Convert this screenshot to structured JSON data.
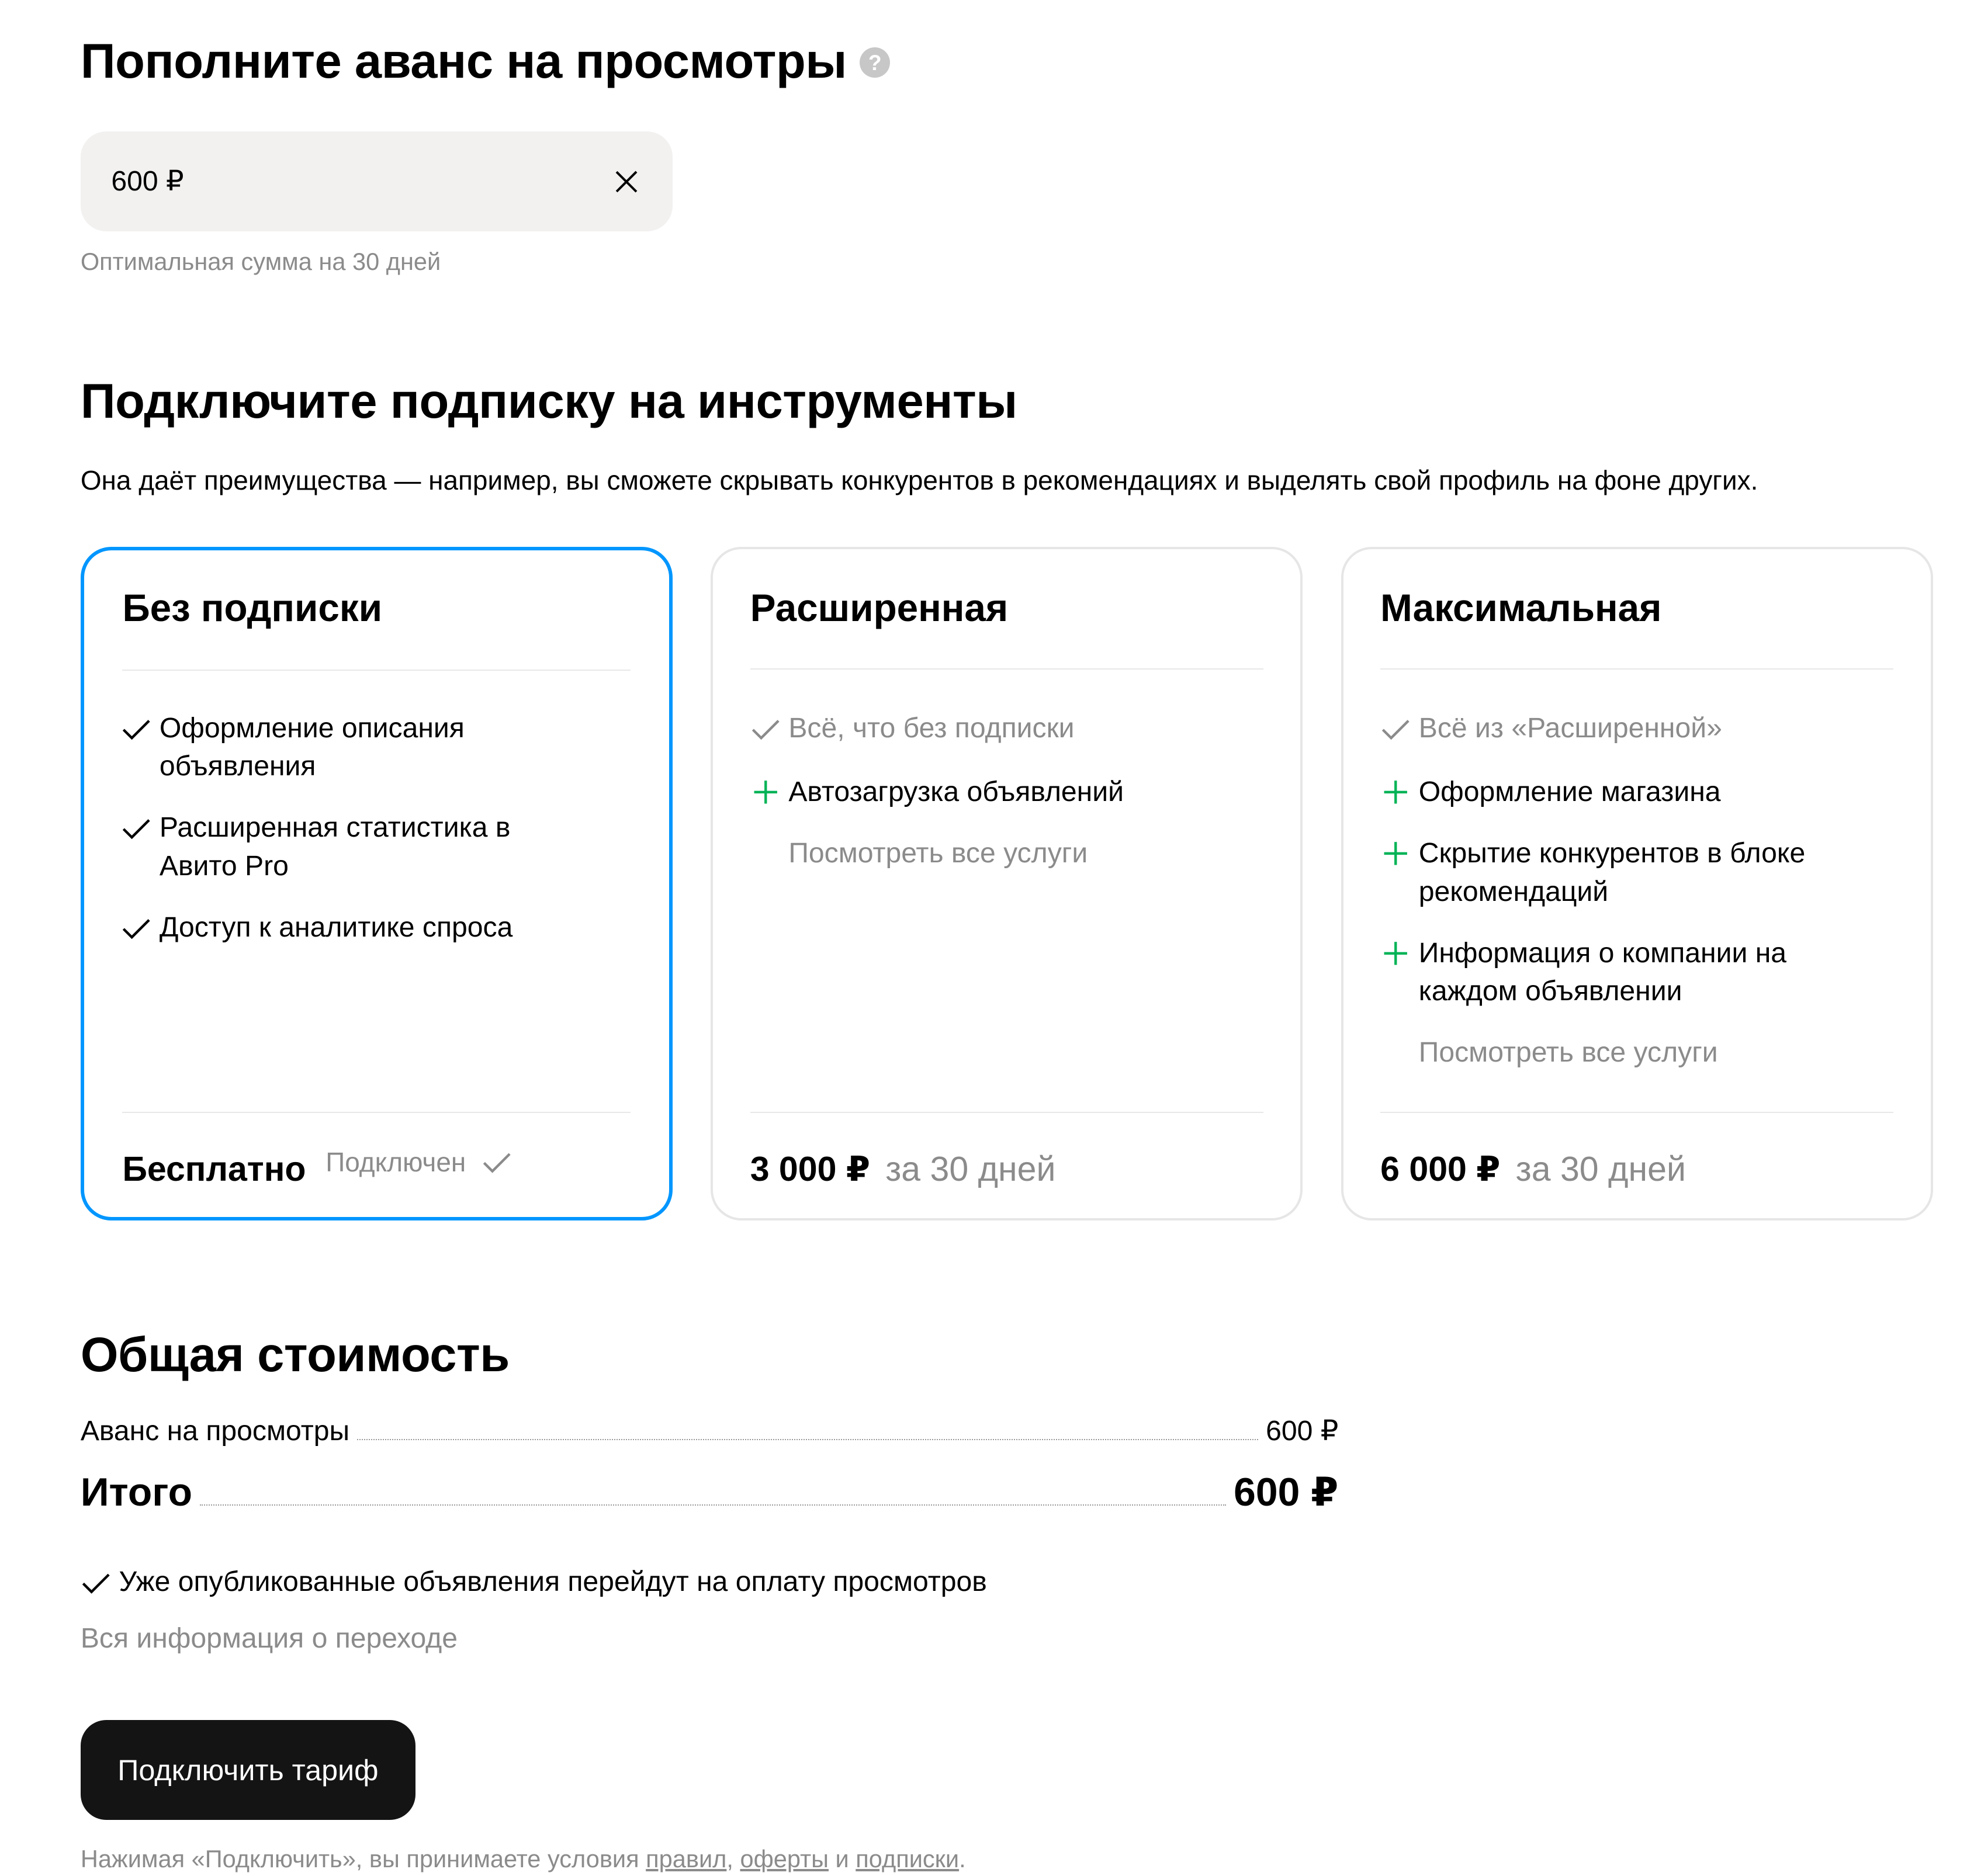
{
  "advance": {
    "title": "Пополните аванс на просмотры",
    "help_icon": "?",
    "amount_value": "600 ₽",
    "hint": "Оптимальная сумма на 30 дней"
  },
  "subscription": {
    "title": "Подключите подписку на инструменты",
    "lead": "Она даёт преимущества — например, вы сможете скрывать конкурентов в рекомендациях и выделять свой профиль на фоне других.",
    "plans": [
      {
        "title": "Без подписки",
        "features": [
          "Оформление описания объявления",
          "Расширенная статистика в Авито Pro",
          "Доступ к аналитике спроса"
        ],
        "price": "Бесплатно",
        "status": "Подключен",
        "selected": true
      },
      {
        "title": "Расширенная",
        "features": [
          "Всё, что без подписки",
          "Автозагрузка объявлений"
        ],
        "all_services_link": "Посмотреть все услуги",
        "price": "3 000 ₽",
        "period": "за 30 дней"
      },
      {
        "title": "Максимальная",
        "features": [
          "Всё из «Расширенной»",
          "Оформление магазина",
          "Скрытие конкурентов в блоке рекомендаций",
          "Информация о компании на каждом объявлении"
        ],
        "all_services_link": "Посмотреть все услуги",
        "price": "6 000 ₽",
        "period": "за 30 дней"
      }
    ]
  },
  "total": {
    "title": "Общая стоимость",
    "advance_label": "Аванс на просмотры",
    "advance_value": "600 ₽",
    "total_label": "Итого",
    "total_value": "600 ₽",
    "note": "Уже опубликованные объявления перейдут на оплату просмотров",
    "info_link": "Вся информация о переходе"
  },
  "cta_label": "Подключить тариф",
  "legal": {
    "prefix": "Нажимая «Подключить», вы принимаете условия ",
    "rules_link": "правил",
    "comma": ", ",
    "offer_link": "оферты",
    "and": " и ",
    "subscription_link": "подписки",
    "suffix": "."
  },
  "colors": {
    "accent_border": "#0096ff",
    "plus_green": "#00b356",
    "button_bg": "#141414",
    "muted_text": "#8b8b8b"
  },
  "icons": {
    "check": "check-icon",
    "plus": "plus-icon",
    "close": "close-icon",
    "help": "help-icon"
  }
}
